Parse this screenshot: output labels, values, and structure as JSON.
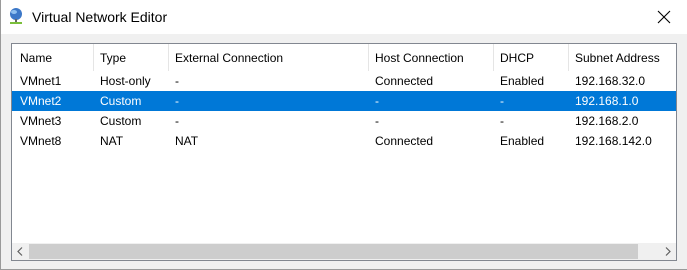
{
  "window": {
    "title": "Virtual Network Editor",
    "app_icon": "network-globe-icon",
    "close_icon": "close-icon"
  },
  "table": {
    "columns": [
      "Name",
      "Type",
      "External Connection",
      "Host Connection",
      "DHCP",
      "Subnet Address"
    ],
    "rows": [
      [
        "VMnet1",
        "Host-only",
        "-",
        "Connected",
        "Enabled",
        "192.168.32.0"
      ],
      [
        "VMnet2",
        "Custom",
        "-",
        "-",
        "-",
        "192.168.1.0"
      ],
      [
        "VMnet3",
        "Custom",
        "-",
        "-",
        "-",
        "192.168.2.0"
      ],
      [
        "VMnet8",
        "NAT",
        "NAT",
        "Connected",
        "Enabled",
        "192.168.142.0"
      ]
    ],
    "selected_row": 1
  },
  "scrollbar": {
    "left_icon": "chevron-left-icon",
    "right_icon": "chevron-right-icon"
  },
  "colors": {
    "selection": "#0078d7",
    "border": "#828790",
    "window_bg": "#f0f0f0"
  }
}
